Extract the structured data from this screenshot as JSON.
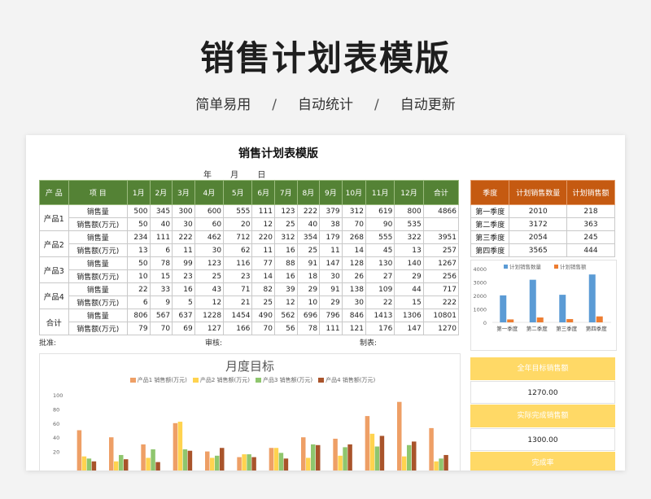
{
  "hero": {
    "title": "销售计划表模版",
    "sub1": "简单易用",
    "sep": "/",
    "sub2": "自动统计",
    "sub3": "自动更新"
  },
  "sheet": {
    "title": "销售计划表模版",
    "date": "年 月 日",
    "headers": [
      "产 品",
      "项 目",
      "1月",
      "2月",
      "3月",
      "4月",
      "5月",
      "6月",
      "7月",
      "8月",
      "9月",
      "10月",
      "11月",
      "12月",
      "合计"
    ],
    "groups": [
      {
        "name": "产品1",
        "rows": [
          {
            "item": "销售量",
            "vals": [
              "500",
              "345",
              "300",
              "600",
              "555",
              "111",
              "123",
              "222",
              "379",
              "312",
              "619",
              "800",
              "4866"
            ]
          },
          {
            "item": "销售额(万元)",
            "vals": [
              "50",
              "40",
              "30",
              "60",
              "20",
              "12",
              "25",
              "40",
              "38",
              "70",
              "90",
              "535",
              ""
            ]
          }
        ]
      },
      {
        "name": "产品2",
        "rows": [
          {
            "item": "销售量",
            "vals": [
              "234",
              "111",
              "222",
              "462",
              "712",
              "220",
              "312",
              "354",
              "179",
              "268",
              "555",
              "322",
              "3951"
            ]
          },
          {
            "item": "销售额(万元)",
            "vals": [
              "13",
              "6",
              "11",
              "30",
              "62",
              "11",
              "16",
              "25",
              "11",
              "14",
              "45",
              "13",
              "257"
            ]
          }
        ]
      },
      {
        "name": "产品3",
        "rows": [
          {
            "item": "销售量",
            "vals": [
              "50",
              "78",
              "99",
              "123",
              "116",
              "77",
              "88",
              "91",
              "147",
              "128",
              "130",
              "140",
              "1267"
            ]
          },
          {
            "item": "销售额(万元)",
            "vals": [
              "10",
              "15",
              "23",
              "25",
              "23",
              "14",
              "16",
              "18",
              "30",
              "26",
              "27",
              "29",
              "256"
            ]
          }
        ]
      },
      {
        "name": "产品4",
        "rows": [
          {
            "item": "销售量",
            "vals": [
              "22",
              "33",
              "16",
              "43",
              "71",
              "82",
              "39",
              "29",
              "91",
              "138",
              "109",
              "44",
              "717"
            ]
          },
          {
            "item": "销售额(万元)",
            "vals": [
              "6",
              "9",
              "5",
              "12",
              "21",
              "25",
              "12",
              "10",
              "29",
              "30",
              "22",
              "15",
              "222"
            ]
          }
        ]
      },
      {
        "name": "合计",
        "rows": [
          {
            "item": "销售量",
            "vals": [
              "806",
              "567",
              "637",
              "1228",
              "1454",
              "490",
              "562",
              "696",
              "796",
              "846",
              "1413",
              "1306",
              "10801"
            ]
          },
          {
            "item": "销售额(万元)",
            "vals": [
              "79",
              "70",
              "69",
              "127",
              "166",
              "70",
              "56",
              "78",
              "111",
              "121",
              "176",
              "147",
              "1270"
            ]
          }
        ]
      }
    ],
    "sign": {
      "approve": "批准:",
      "review": "审核:",
      "make": "制表:"
    }
  },
  "quarter": {
    "headers": [
      "季度",
      "计划销售数量",
      "计划销售额"
    ],
    "rows": [
      [
        "第一季度",
        "2010",
        "218"
      ],
      [
        "第二季度",
        "3172",
        "363"
      ],
      [
        "第三季度",
        "2054",
        "245"
      ],
      [
        "第四季度",
        "3565",
        "444"
      ]
    ]
  },
  "kpis": {
    "label1": "全年目标销售额",
    "value1": "1270.00",
    "label2": "实际完成销售额",
    "value2": "1300.00",
    "label3": "完成率"
  },
  "chart_data": [
    {
      "type": "bar",
      "categories": [
        "第一季度",
        "第二季度",
        "第三季度",
        "第四季度"
      ],
      "series": [
        {
          "name": "计划销售数量",
          "values": [
            2010,
            3172,
            2054,
            3565
          ],
          "color": "#5b9bd5"
        },
        {
          "name": "计划销售额",
          "values": [
            218,
            363,
            245,
            444
          ],
          "color": "#ed7d31"
        }
      ],
      "ylim": [
        0,
        4000
      ],
      "yticks": [
        0,
        1000,
        2000,
        3000,
        4000
      ],
      "legend": "top"
    },
    {
      "type": "bar",
      "title": "月度目标",
      "categories": [
        "1月",
        "2月",
        "3月",
        "4月",
        "5月",
        "6月",
        "7月",
        "8月",
        "9月",
        "10月",
        "11月",
        "12月"
      ],
      "series": [
        {
          "name": "产品1 销售额(万元)",
          "values": [
            50,
            40,
            30,
            60,
            20,
            12,
            25,
            40,
            38,
            70,
            90,
            53
          ],
          "color": "#ee9f66"
        },
        {
          "name": "产品2 销售额(万元)",
          "values": [
            13,
            6,
            11,
            62,
            11,
            16,
            25,
            11,
            14,
            45,
            13,
            6
          ],
          "color": "#ffd34f"
        },
        {
          "name": "产品3 销售额(万元)",
          "values": [
            10,
            15,
            23,
            23,
            14,
            16,
            18,
            30,
            26,
            27,
            29,
            10
          ],
          "color": "#8fc66e"
        },
        {
          "name": "产品4 销售额(万元)",
          "values": [
            6,
            9,
            5,
            21,
            25,
            12,
            10,
            29,
            30,
            42,
            34,
            15
          ],
          "color": "#a9542b"
        }
      ],
      "ylim": [
        0,
        100
      ],
      "yticks": [
        20,
        40,
        60,
        80,
        100
      ],
      "legend": "top"
    }
  ]
}
